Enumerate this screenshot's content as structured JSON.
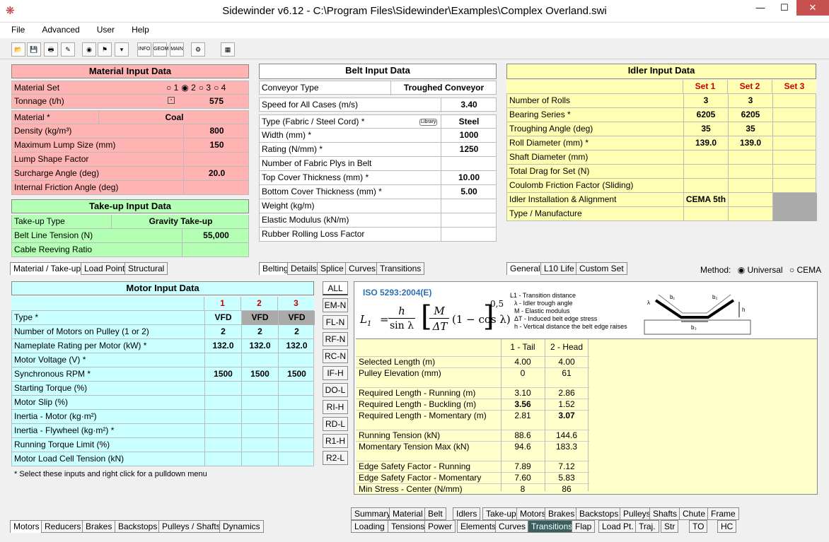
{
  "window": {
    "title": "Sidewinder v6.12 - C:\\Program Files\\Sidewinder\\Examples\\Complex Overland.swi",
    "min": "—",
    "max": "☐",
    "close": "✕"
  },
  "menu": [
    "File",
    "Advanced",
    "User",
    "Help"
  ],
  "toolbar": {
    "icons": [
      "open-icon",
      "save-icon",
      "print-icon",
      "edit-icon",
      "globe-icon",
      "flag-icon",
      "dropdown-icon",
      "info-icon",
      "geom-icon",
      "main-icon",
      "tools-icon",
      "calculator-icon"
    ],
    "labels": {
      "info": "INFO",
      "geom": "GEOM",
      "main": "MAIN"
    }
  },
  "material": {
    "title": "Material Input Data",
    "set_label": "Material Set",
    "set_options": [
      "1",
      "2",
      "3",
      "4"
    ],
    "set_selected": "2",
    "tonnage_label": "Tonnage (t/h)",
    "tonnage": "575",
    "material_label": "Material *",
    "material_value": "Coal",
    "rows": [
      {
        "label": "Density (kg/m³)",
        "value": "800"
      },
      {
        "label": "Maximum Lump Size (mm)",
        "value": "150"
      },
      {
        "label": "Lump Shape Factor",
        "value": ""
      },
      {
        "label": "Surcharge Angle (deg)",
        "value": "20.0"
      },
      {
        "label": "Internal Friction Angle (deg)",
        "value": ""
      }
    ]
  },
  "takeup": {
    "title": "Take-up Input Data",
    "rows": [
      {
        "label": "Take-up Type",
        "value": "Gravity Take-up"
      },
      {
        "label": "Belt Line Tension (N)",
        "value": "55,000"
      },
      {
        "label": "Cable Reeving Ratio",
        "value": ""
      }
    ]
  },
  "left_tabs": [
    "Material / Take-up",
    "Load Point",
    "Structural"
  ],
  "belt": {
    "title": "Belt Input Data",
    "conveyor_label": "Conveyor Type",
    "conveyor_value": "Troughed Conveyor",
    "speed_label": "Speed for All Cases (m/s)",
    "speed_value": "3.40",
    "type_label": "Type (Fabric / Steel Cord) *",
    "library": "Library",
    "type_value": "Steel",
    "rows": [
      {
        "label": "Width (mm) *",
        "value": "1000"
      },
      {
        "label": "Rating (N/mm) *",
        "value": "1250"
      },
      {
        "label": "Number of Fabric Plys in Belt",
        "value": ""
      },
      {
        "label": "Top Cover Thickness (mm) *",
        "value": "10.00"
      },
      {
        "label": "Bottom Cover Thickness (mm) *",
        "value": "5.00"
      },
      {
        "label": "Weight (kg/m)",
        "value": ""
      },
      {
        "label": "Elastic Modulus (kN/m)",
        "value": ""
      },
      {
        "label": "Rubber Rolling Loss Factor",
        "value": ""
      }
    ]
  },
  "belt_tabs": [
    "Belting",
    "Details",
    "Splice",
    "Curves",
    "Transitions"
  ],
  "idler": {
    "title": "Idler Input Data",
    "sets": [
      "Set 1",
      "Set 2",
      "Set 3"
    ],
    "rows": [
      {
        "label": "Number of Rolls",
        "v": [
          "3",
          "3",
          ""
        ]
      },
      {
        "label": "Bearing Series *",
        "v": [
          "6205",
          "6205",
          ""
        ]
      },
      {
        "label": "Troughing Angle (deg)",
        "v": [
          "35",
          "35",
          ""
        ]
      },
      {
        "label": "Roll Diameter (mm) *",
        "v": [
          "139.0",
          "139.0",
          ""
        ]
      },
      {
        "label": "Shaft Diameter (mm)",
        "v": [
          "",
          "",
          ""
        ]
      },
      {
        "label": "Total Drag for Set (N)",
        "v": [
          "",
          "",
          ""
        ]
      },
      {
        "label": "Coulomb Friction Factor (Sliding)",
        "v": [
          "",
          "",
          ""
        ]
      },
      {
        "label": "Idler Installation & Alignment",
        "v": [
          "CEMA 5th",
          "",
          ""
        ]
      },
      {
        "label": "Type / Manufacture",
        "v": [
          "",
          "",
          ""
        ]
      }
    ]
  },
  "idler_tabs": [
    "General",
    "L10 Life",
    "Custom Set"
  ],
  "method": {
    "label": "Method:",
    "options": [
      "Universal",
      "CEMA"
    ],
    "selected": "Universal"
  },
  "motor": {
    "title": "Motor Input Data",
    "cols": [
      "1",
      "2",
      "3"
    ],
    "rows": [
      {
        "label": "Type *",
        "v": [
          "VFD",
          "VFD",
          "VFD"
        ]
      },
      {
        "label": "Number of Motors on Pulley (1 or 2)",
        "v": [
          "2",
          "2",
          "2"
        ]
      },
      {
        "label": "Nameplate Rating per Motor (kW) *",
        "v": [
          "132.0",
          "132.0",
          "132.0"
        ]
      },
      {
        "label": "Motor Voltage (V) *",
        "v": [
          "",
          "",
          ""
        ]
      },
      {
        "label": "Synchronous RPM *",
        "v": [
          "1500",
          "1500",
          "1500"
        ]
      },
      {
        "label": "Starting Torque (%)",
        "v": [
          "",
          "",
          ""
        ]
      },
      {
        "label": "Motor Slip (%)",
        "v": [
          "",
          "",
          ""
        ]
      },
      {
        "label": "Inertia - Motor (kg·m²)",
        "v": [
          "",
          "",
          ""
        ]
      },
      {
        "label": "Inertia - Flywheel (kg·m²) *",
        "v": [
          "",
          "",
          ""
        ]
      },
      {
        "label": "Running Torque Limit (%)",
        "v": [
          "",
          "",
          ""
        ]
      },
      {
        "label": "Motor Load Cell Tension (kN)",
        "v": [
          "",
          "",
          ""
        ]
      }
    ],
    "note": "* Select these inputs and right click for a pulldown menu"
  },
  "motor_tabs": [
    "Motors",
    "Reducers",
    "Brakes",
    "Backstops",
    "Pulleys / Shafts",
    "Dynamics"
  ],
  "vbuttons": [
    "ALL",
    "EM-N",
    "FL-N",
    "RF-N",
    "RC-N",
    "IF-H",
    "DO-L",
    "RI-H",
    "RD-L",
    "R1-H",
    "R2-L"
  ],
  "transition": {
    "iso": "ISO 5293:2004(E)",
    "legend": [
      "L1 - Transition distance",
      "λ - Idler trough angle",
      "M - Elastic modulus",
      "ΔT - Induced belt edge stress",
      "h - Vertical distance the belt edge raises"
    ],
    "formula": {
      "l1": "L",
      "sub": "1",
      "eq": "=",
      "num": "h",
      "den": "sin λ",
      "mnum": "M",
      "mden": "ΔT",
      "tail": "(1 − cos λ)",
      "exp": "0,5"
    },
    "fig_labels": {
      "b1": "b₁",
      "b2": "b₂",
      "b3": "b₃",
      "h": "h",
      "lam": "λ"
    },
    "headers": [
      "1 - Tail",
      "2 - Head"
    ],
    "rows": [
      {
        "label": "Selected Length (m)",
        "v": [
          "4.00",
          "4.00"
        ]
      },
      {
        "label": "Pulley Elevation (mm)",
        "v": [
          "0",
          "61"
        ]
      },
      {
        "label": "Required Length - Running (m)",
        "v": [
          "3.10",
          "2.86"
        ]
      },
      {
        "label": "Required Length - Buckling (m)",
        "v": [
          "3.56",
          "1.52"
        ]
      },
      {
        "label": "Required Length - Momentary (m)",
        "v": [
          "2.81",
          "3.07"
        ]
      },
      {
        "label": "Running Tension (kN)",
        "v": [
          "88.6",
          "144.6"
        ]
      },
      {
        "label": "Momentary Tension Max (kN)",
        "v": [
          "94.6",
          "183.3"
        ]
      },
      {
        "label": "Edge Safety Factor - Running",
        "v": [
          "7.89",
          "7.12"
        ]
      },
      {
        "label": "Edge Safety Factor - Momentary",
        "v": [
          "7.60",
          "5.83"
        ]
      },
      {
        "label": "Min Stress - Center (N/mm)",
        "v": [
          "8",
          "86"
        ]
      }
    ]
  },
  "bottom_tabs_row1": [
    "Summary",
    "Material",
    "Belt",
    "Idlers",
    "Take-up",
    "Motors",
    "Brakes",
    "Backstops",
    "Pulleys",
    "Shafts",
    "Chute",
    "Frame"
  ],
  "bottom_tabs_row2": [
    "Loading",
    "Tensions",
    "Power",
    "Elements",
    "Curves",
    "Transitions",
    "Flap",
    "Load Pt.",
    "Traj.",
    "Str",
    "TO",
    "HC"
  ],
  "colors": {
    "pink": "#ffb3b3",
    "green": "#b3ffb3",
    "yellow": "#ffffb3",
    "cyan": "#c9ffff"
  }
}
